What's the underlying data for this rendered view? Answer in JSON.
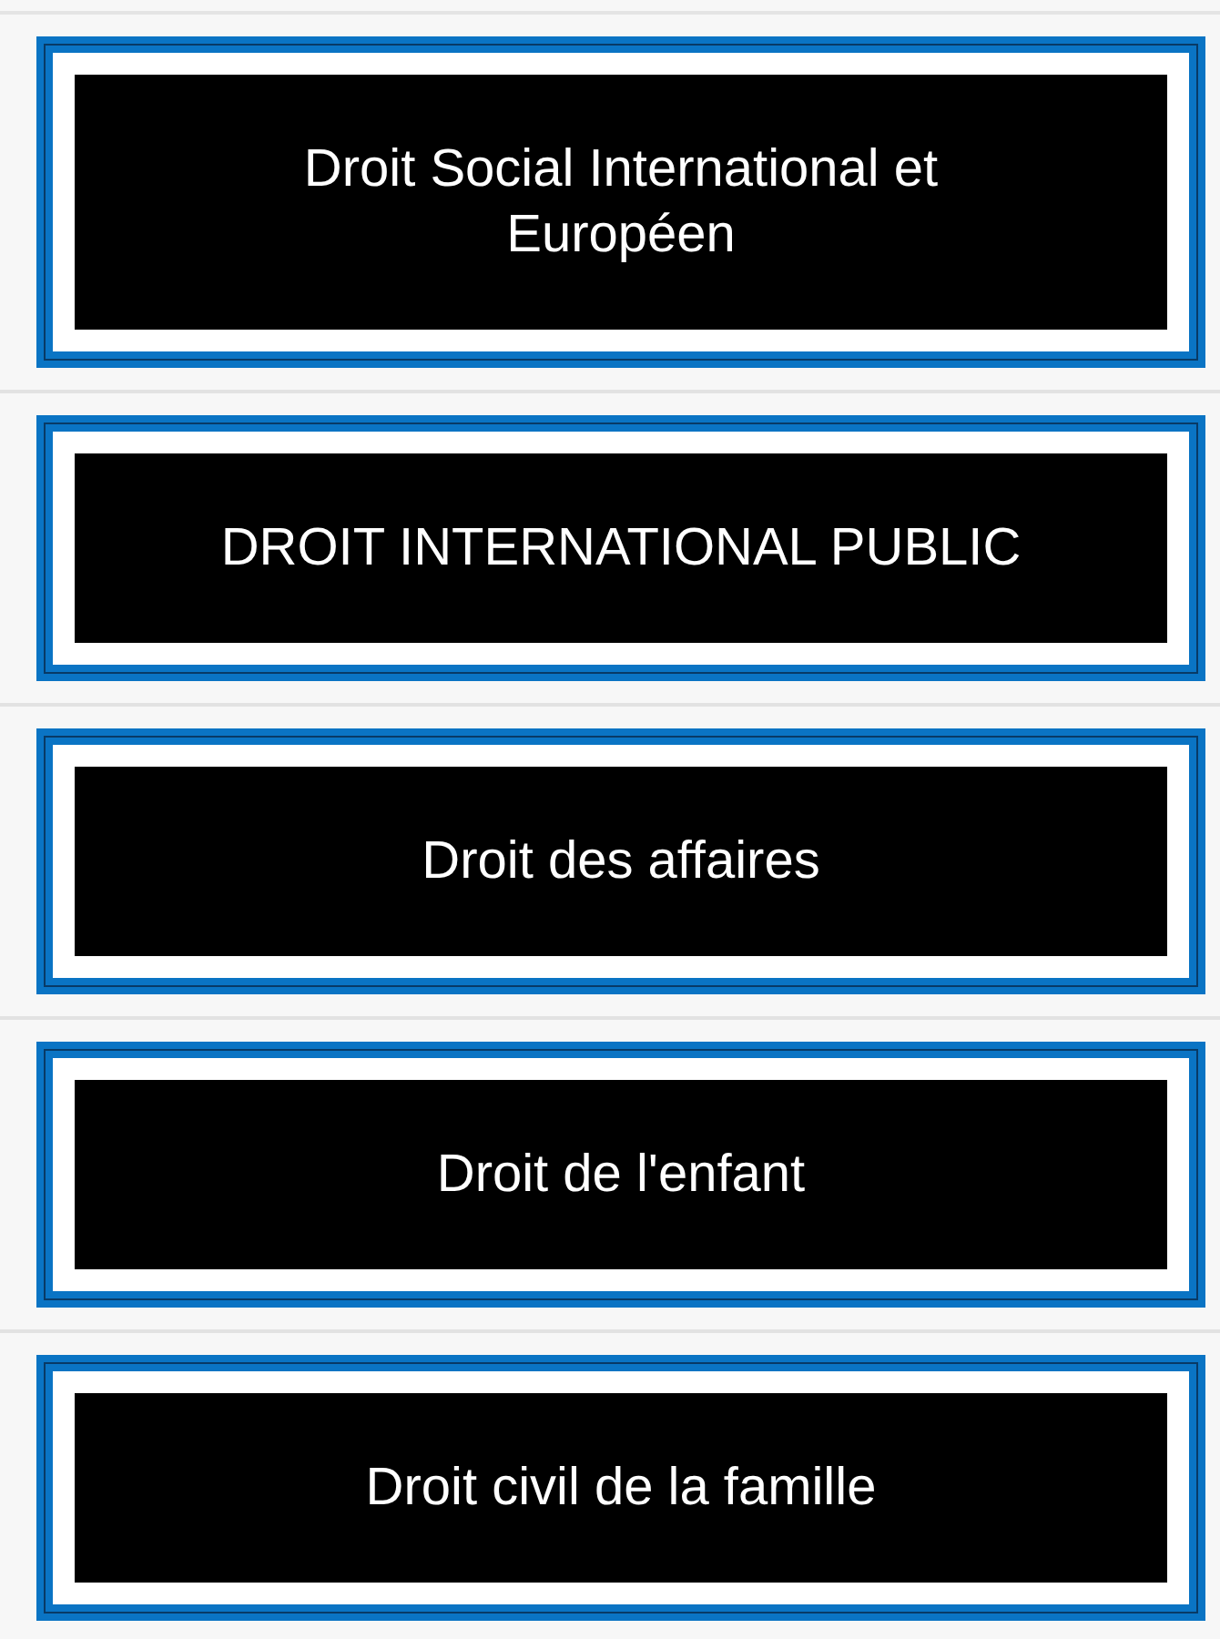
{
  "buttons": [
    {
      "label": "Droit Social International et Européen"
    },
    {
      "label": "DROIT INTERNATIONAL PUBLIC"
    },
    {
      "label": "Droit des affaires"
    },
    {
      "label": "Droit de l'enfant"
    },
    {
      "label": "Droit civil de la famille"
    }
  ]
}
